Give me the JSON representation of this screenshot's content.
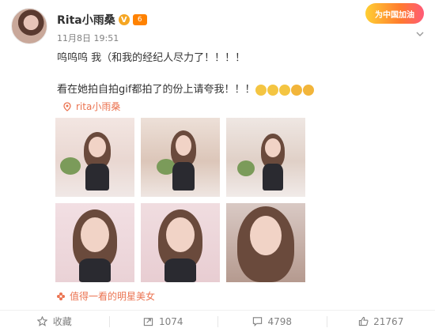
{
  "post": {
    "username": "Rita小雨桑",
    "verified_badge": "V",
    "vip_badge": "6",
    "timestamp": "11月8日 19:51",
    "line1": "呜呜呜 我（和我的经纪人尽力了！！！！",
    "line2": "看在她拍自拍gif都拍了的份上请夸我！！！",
    "topic": "rita小雨桑",
    "tagline": "值得一看的明星美女",
    "badge_text": "为中国加油"
  },
  "actions": {
    "favorite_label": "收藏",
    "repost_count": "1074",
    "comment_count": "4798",
    "like_count": "21767"
  },
  "colors": {
    "accent": "#eb7350",
    "vip": "#ff8200",
    "verified": "#f5a623"
  }
}
